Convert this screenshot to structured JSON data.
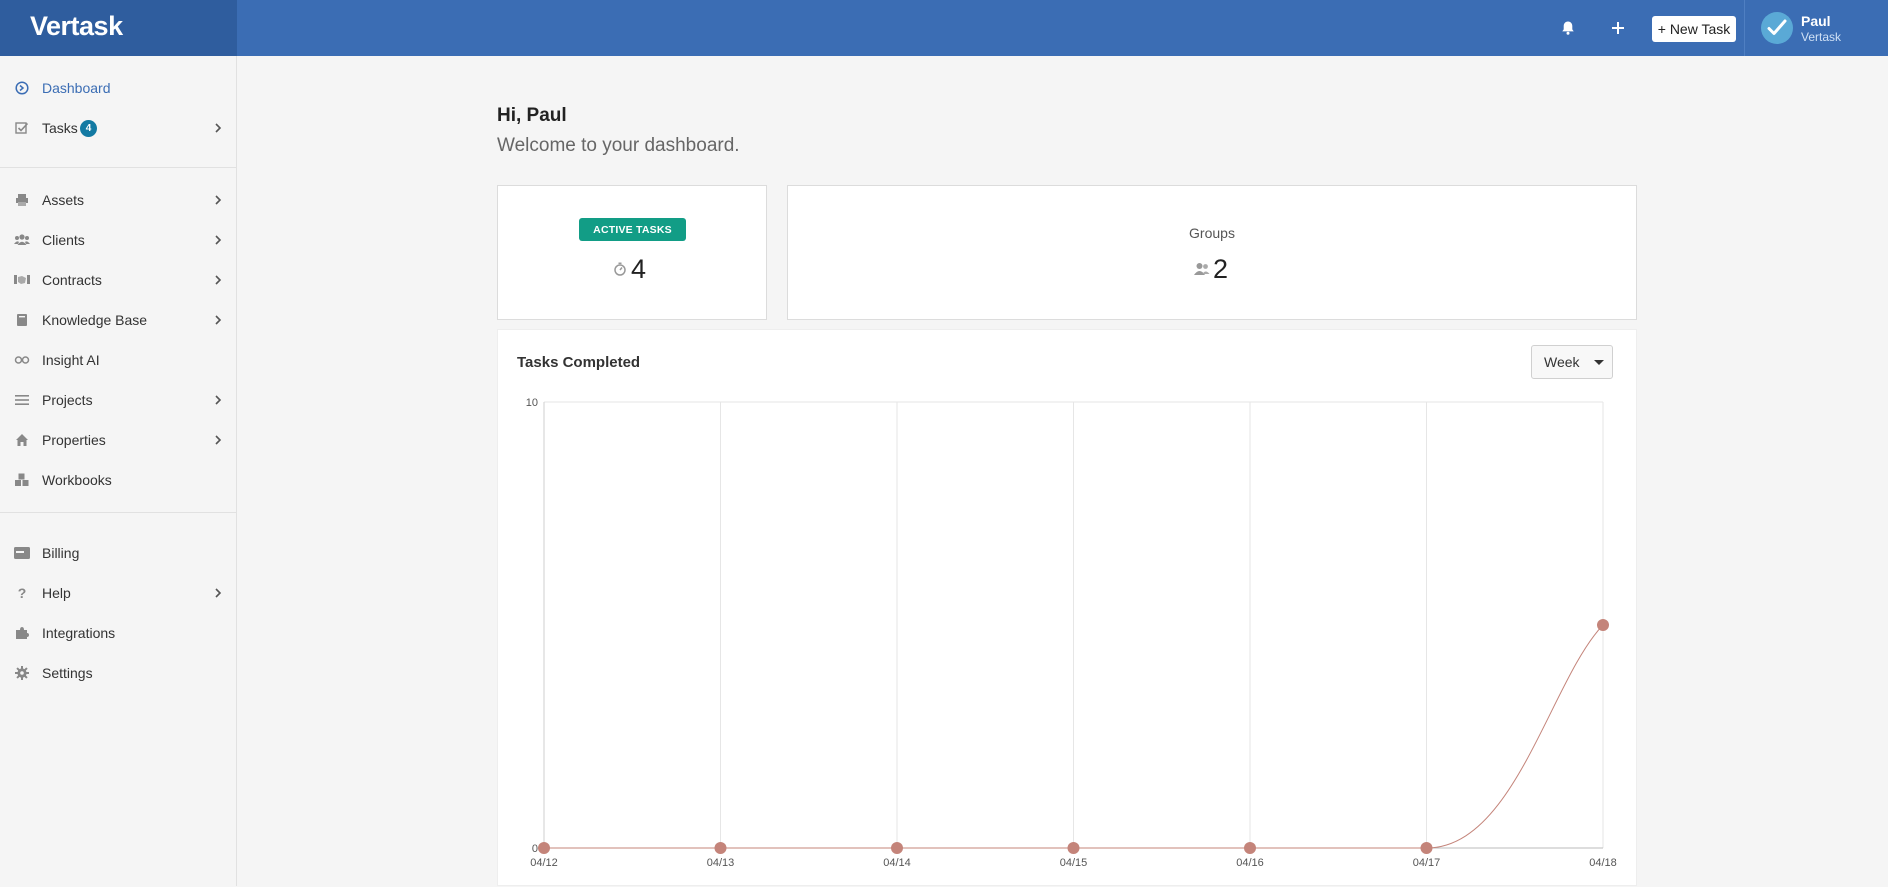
{
  "header": {
    "brand": "Vertask",
    "new_task_label": "+ New Task",
    "user": {
      "name": "Paul",
      "org": "Vertask"
    },
    "icons": [
      "bell-icon",
      "plus-icon"
    ]
  },
  "sidebar": {
    "items": [
      {
        "label": "Dashboard",
        "icon": "dashboard-icon"
      },
      {
        "label": "Tasks",
        "icon": "tasks-icon",
        "badge": "4"
      },
      {
        "label": "Assets",
        "icon": "printer-icon"
      },
      {
        "label": "Clients",
        "icon": "users-icon"
      },
      {
        "label": "Contracts",
        "icon": "contract-icon"
      },
      {
        "label": "Knowledge Base",
        "icon": "book-icon"
      },
      {
        "label": "Insight AI",
        "icon": "infinity-icon"
      },
      {
        "label": "Projects",
        "icon": "list-icon"
      },
      {
        "label": "Properties",
        "icon": "home-icon"
      },
      {
        "label": "Workbooks",
        "icon": "cubes-icon"
      },
      {
        "label": "Billing",
        "icon": "card-icon"
      },
      {
        "label": "Help",
        "icon": "question-icon"
      },
      {
        "label": "Integrations",
        "icon": "puzzle-icon"
      },
      {
        "label": "Settings",
        "icon": "gear-icon"
      }
    ]
  },
  "main": {
    "greeting": "Hi, Paul",
    "welcome": "Welcome to your dashboard.",
    "active_tasks": {
      "label": "ACTIVE TASKS",
      "value": "4"
    },
    "groups": {
      "label": "Groups",
      "value": "2"
    },
    "chart_select": "Week"
  },
  "colors": {
    "accent": "#3b6db4",
    "brand_dark": "#2f5d9e",
    "active_tasks_green": "#129d86",
    "badge": "#137aa3",
    "series": "#c4847a"
  },
  "chart_data": {
    "type": "line",
    "title": "Tasks Completed",
    "x": [
      "04/12",
      "04/13",
      "04/14",
      "04/15",
      "04/16",
      "04/17",
      "04/18"
    ],
    "values": [
      0,
      0,
      0,
      0,
      0,
      0,
      5
    ],
    "ylim": [
      0,
      10
    ],
    "yticks": [
      "0",
      "10"
    ],
    "grid": true
  }
}
